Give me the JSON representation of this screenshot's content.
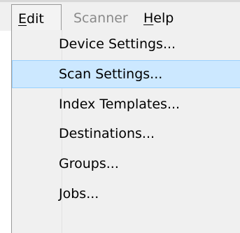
{
  "menubar": {
    "edit": {
      "mnemonic": "E",
      "rest": "dit"
    },
    "scanner": {
      "label": "Scanner"
    },
    "help": {
      "mnemonic": "H",
      "rest": "elp"
    }
  },
  "edit_menu": {
    "items": [
      {
        "label": "Device Settings..."
      },
      {
        "label": "Scan Settings...",
        "highlighted": true
      },
      {
        "label": "Index Templates..."
      },
      {
        "label": "Destinations..."
      },
      {
        "label": "Groups..."
      },
      {
        "label": "Jobs..."
      }
    ]
  },
  "colors": {
    "menu_background": "#f0f0f0",
    "highlight_fill": "#cce8ff",
    "highlight_border": "#99d1ff",
    "disabled_text": "#8a8a8a"
  }
}
